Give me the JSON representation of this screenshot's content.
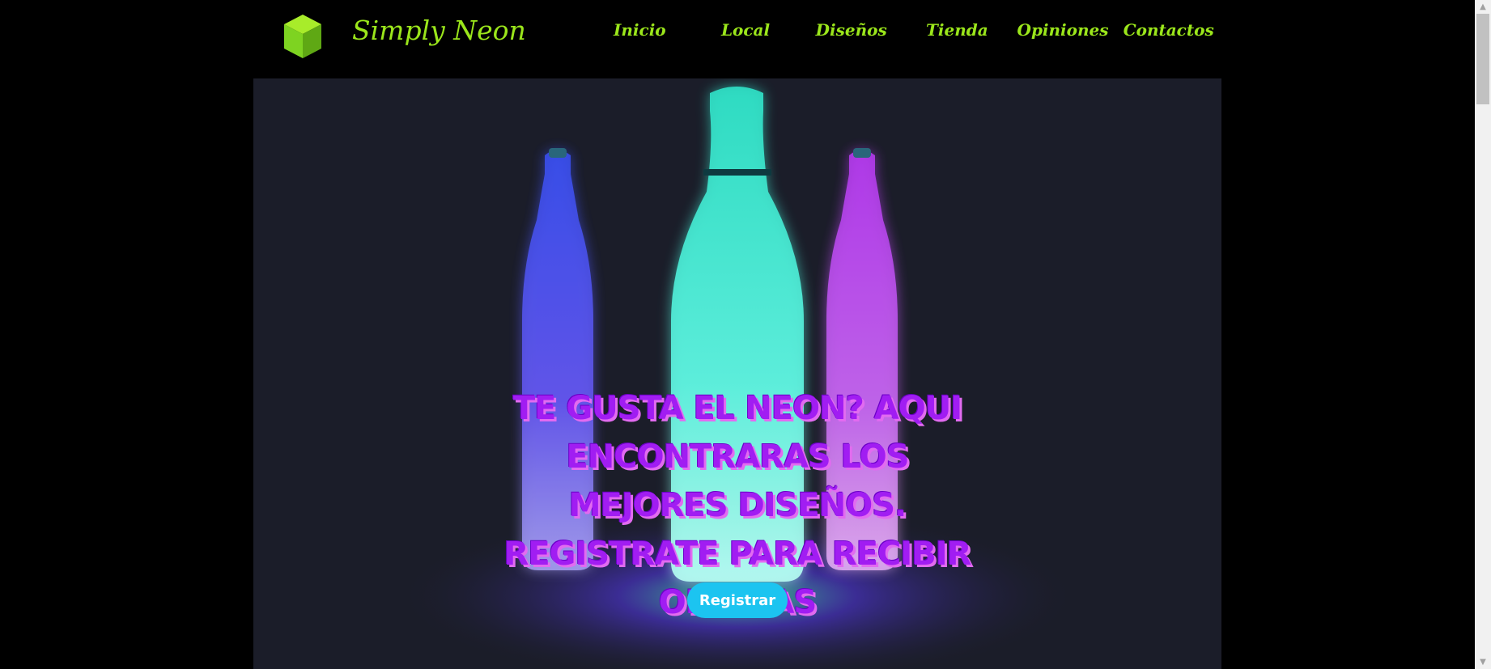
{
  "brand": {
    "name": "Simply Neon",
    "icon": "green-cube-icon",
    "color": "#9be61b"
  },
  "nav": {
    "items": [
      {
        "label": "Inicio"
      },
      {
        "label": "Local"
      },
      {
        "label": "Diseños"
      },
      {
        "label": "Tienda"
      },
      {
        "label": "Opiniones"
      },
      {
        "label": "Contactos"
      }
    ]
  },
  "hero": {
    "headline": "Te gusta el neon? aqui encontraras los mejores diseños. Registrate para recibir ofertas",
    "button_label": "Registrar",
    "image": "neon-bottles-image",
    "colors": {
      "headline": "#a11df2",
      "button": "#1cc4f0",
      "background": "#1b1d29"
    }
  },
  "scrollbar": {
    "up_icon": "scroll-up-arrow-icon",
    "down_icon": "scroll-down-arrow-icon"
  }
}
